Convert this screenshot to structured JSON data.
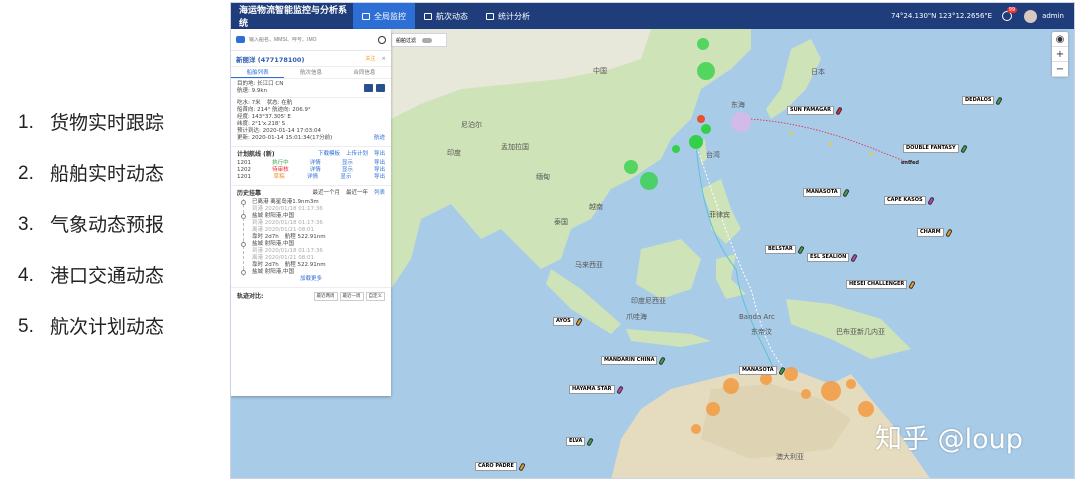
{
  "slide": {
    "items": [
      {
        "num": "1.",
        "label": "货物实时跟踪"
      },
      {
        "num": "2.",
        "label": "船舶实时动态"
      },
      {
        "num": "3.",
        "label": "气象动态预报"
      },
      {
        "num": "4.",
        "label": "港口交通动态"
      },
      {
        "num": "5.",
        "label": "航次计划动态"
      }
    ]
  },
  "app": {
    "title": "海运物流智能监控与分析系统",
    "nav": [
      {
        "label": "全局监控",
        "active": true
      },
      {
        "label": "航次动态",
        "active": false
      },
      {
        "label": "统计分析",
        "active": false
      }
    ],
    "coordinates": "74°24.130\"N 123°12.2656\"E",
    "notification_count": "99",
    "user": "admin"
  },
  "search": {
    "placeholder": "输入船名、MMSI、呼号、IMO",
    "filter_label": "船舶过滤"
  },
  "ship": {
    "name": "新丽洋 (477178100)",
    "follow_label": "关注",
    "close": "×",
    "tabs": [
      "船舶列表",
      "航次信息",
      "合同信息"
    ],
    "destination": "目的地: 长江口 CN",
    "speed": "航速: 9.9kn",
    "draught": "吃水: 7米",
    "status": "状态: 在航",
    "heading_course": "船首向: 214°  航迹向: 206.9°",
    "lon": "经度: 143°37.305' E",
    "lat": "纬度: 2°1'x.218' S",
    "eta": "预计到达: 2020-01-14 17:03:04",
    "updated": "更新: 2020-01-14 15:01:34(17分前)",
    "track_link": "航迹"
  },
  "plan": {
    "title": "计划航线 (新)",
    "actions": [
      "下载模板",
      "上传计划",
      "导出"
    ],
    "rows": [
      {
        "id": "1201",
        "status": "执行中",
        "status_class": "green",
        "a": "详情",
        "b": "显示",
        "c": "导出"
      },
      {
        "id": "1202",
        "status": "待审核",
        "status_class": "red",
        "a": "详情",
        "b": "显示",
        "c": "导出"
      },
      {
        "id": "1201",
        "status": "草稿",
        "status_class": "orange",
        "a": "详情",
        "b": "显示",
        "c": "导出"
      }
    ]
  },
  "history": {
    "title": "历史挂靠",
    "option1": "最近一个月",
    "option2": "最近一年",
    "more_link": "列表",
    "first": "已离港 离星岛港1.9nm3m",
    "first_time": "到港 2020/01/18 01:17:36",
    "entries": [
      {
        "port": "盐城 射阳港,中国",
        "time1": "到港 2020/01/18 01:17:36",
        "time2": "离港 2020/01/21 08:01",
        "stay": "靠时 2d7h",
        "dist": "航程 522.91nm"
      },
      {
        "port": "盐城 射阳港,中国",
        "time1": "到港 2020/01/18 01:17:36",
        "time2": "离港 2020/01/21 08:01",
        "stay": "靠时 2d7h",
        "dist": "航程 522.91nm"
      },
      {
        "port": "盐城 射阳港,中国",
        "time1": "",
        "time2": "",
        "stay": "",
        "dist": ""
      }
    ],
    "load_more": "加载更多"
  },
  "compare": {
    "label": "轨迹对比:",
    "buttons": [
      "最近两周",
      "最近一周",
      "自定义"
    ]
  },
  "map_labels": {
    "china": "中国",
    "india": "印度",
    "indonesia": "印度尼西亚",
    "australia": "澳大利亚",
    "philippines": "菲律宾",
    "vietnam": "越南",
    "thailand": "泰国",
    "malaysia": "马来西亚",
    "taiwan": "台湾",
    "japan": "日本",
    "png": "巴布亚新几内亚",
    "myanmar": "缅甸",
    "bangladesh": "孟加拉国",
    "nepal": "尼泊尔",
    "donghai": "东海",
    "java": "爪哇海",
    "banda": "Banda Arc",
    "timor": "东帝汶"
  },
  "ship_markers": [
    {
      "label": "DEDALOS",
      "color": "#3aa643"
    },
    {
      "label": "DOUBLE FANTASY",
      "color": "#3aa643"
    },
    {
      "label": "MANASOTA",
      "color": "#3aa643"
    },
    {
      "label": "CAPE KASOS",
      "color": "#c040c0"
    },
    {
      "label": "CHARM",
      "color": "#f0a020"
    },
    {
      "label": "BELSTAR",
      "color": "#3aa643"
    },
    {
      "label": "ESL SEALION",
      "color": "#c040c0"
    },
    {
      "label": "HESEI CHALLENGER",
      "color": "#f0a020"
    },
    {
      "label": "AYOS",
      "color": "#f0a020"
    },
    {
      "label": "MANDARIN CHINA",
      "color": "#3aa643"
    },
    {
      "label": "MANASOTA",
      "color": "#3aa643"
    },
    {
      "label": "HAYAMA STAR",
      "color": "#c040c0"
    },
    {
      "label": "ELVA",
      "color": "#3aa643"
    },
    {
      "label": "CARO PADRE",
      "color": "#f0a020"
    },
    {
      "label": "SUN FAMAGAR",
      "color": "#e23"
    }
  ],
  "typhoon_label": "enffed",
  "watermark": "知乎 @loup",
  "zoom": {
    "in": "+",
    "out": "−"
  }
}
